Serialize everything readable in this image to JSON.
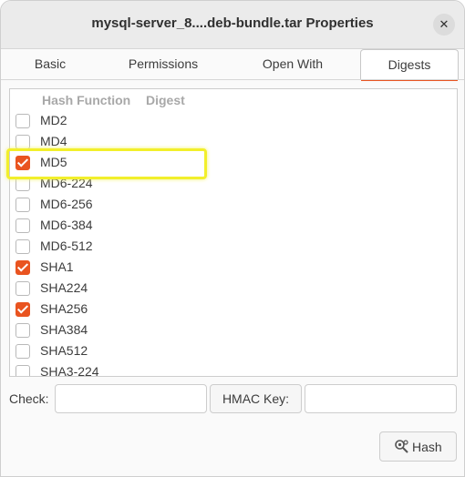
{
  "window": {
    "title": "mysql-server_8....deb-bundle.tar Properties",
    "close_glyph": "✕"
  },
  "tabs": [
    {
      "label": "Basic",
      "active": false
    },
    {
      "label": "Permissions",
      "active": false
    },
    {
      "label": "Open With",
      "active": false
    },
    {
      "label": "Digests",
      "active": true
    }
  ],
  "colors": {
    "accent": "#e95420",
    "highlight": "#f2ef2b"
  },
  "digests": {
    "columns": [
      "Hash Function",
      "Digest"
    ],
    "rows": [
      {
        "name": "MD2",
        "checked": false
      },
      {
        "name": "MD4",
        "checked": false
      },
      {
        "name": "MD5",
        "checked": true
      },
      {
        "name": "MD6-224",
        "checked": false
      },
      {
        "name": "MD6-256",
        "checked": false
      },
      {
        "name": "MD6-384",
        "checked": false
      },
      {
        "name": "MD6-512",
        "checked": false
      },
      {
        "name": "SHA1",
        "checked": true
      },
      {
        "name": "SHA224",
        "checked": false
      },
      {
        "name": "SHA256",
        "checked": true
      },
      {
        "name": "SHA384",
        "checked": false
      },
      {
        "name": "SHA512",
        "checked": false
      },
      {
        "name": "SHA3-224",
        "checked": false
      }
    ]
  },
  "check": {
    "label": "Check:",
    "value": ""
  },
  "hmac": {
    "button_label": "HMAC Key:",
    "value": ""
  },
  "hash_button": {
    "label": "Hash",
    "icon": "magnifier-gears-icon"
  }
}
